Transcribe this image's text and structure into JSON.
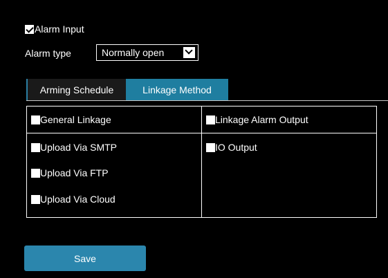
{
  "alarm_input": {
    "label": "Alarm Input",
    "checked": true
  },
  "alarm_type": {
    "label": "Alarm type",
    "value": "Normally open"
  },
  "tabs": [
    {
      "label": "Arming Schedule",
      "active": false
    },
    {
      "label": "Linkage Method",
      "active": true
    }
  ],
  "linkage": {
    "general_header": "General Linkage",
    "alarm_output_header": "Linkage Alarm Output",
    "smtp": "Upload Via SMTP",
    "ftp": "Upload Via FTP",
    "cloud": "Upload Via Cloud",
    "io_output": "IO Output"
  },
  "save_label": "Save",
  "colors": {
    "background": "#000000",
    "accent": "#1f7ea0",
    "button": "#2b86ad",
    "text": "#ffffff"
  }
}
